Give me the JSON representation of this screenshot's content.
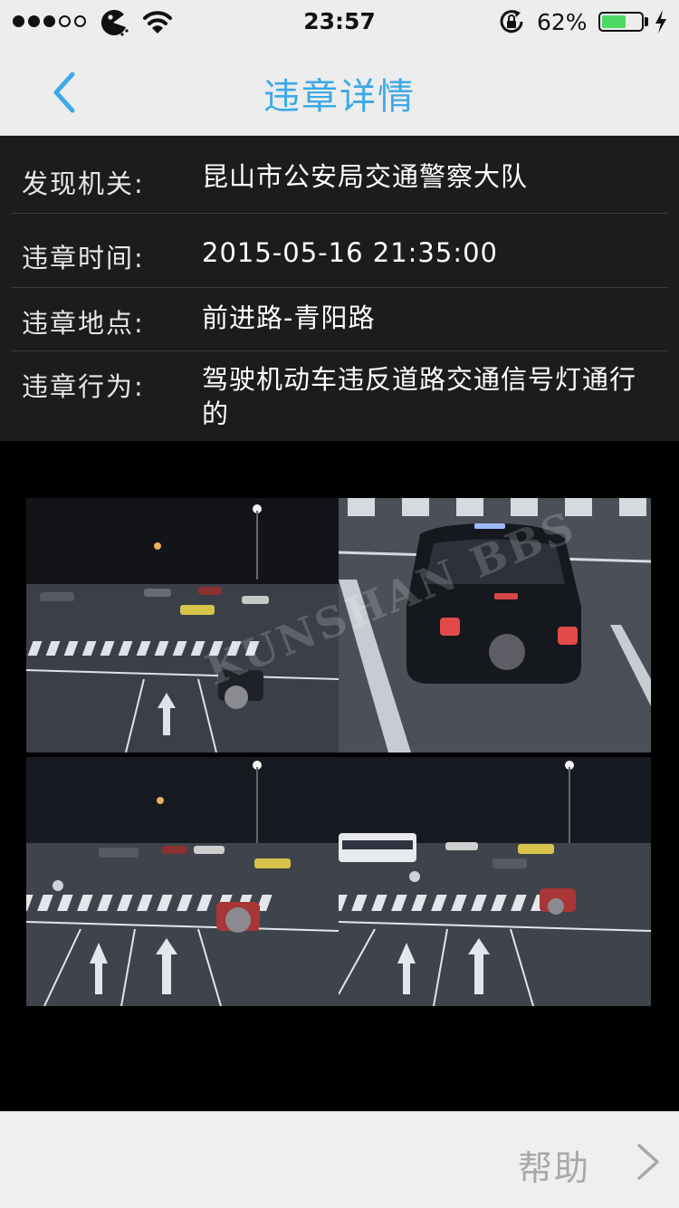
{
  "status_bar": {
    "time": "23:57",
    "battery_percent": "62%",
    "battery_level": 0.62,
    "signal_bars_filled": 3,
    "signal_bars_total": 5
  },
  "nav": {
    "title": "违章详情",
    "back_icon": "chevron-left-icon"
  },
  "violation": {
    "rows": [
      {
        "label": "发现机关:",
        "value": "昆山市公安局交通警察大队"
      },
      {
        "label": "违章时间:",
        "value": "2015-05-16 21:35:00"
      },
      {
        "label": "违章地点:",
        "value": "前进路-青阳路"
      },
      {
        "label": "违章行为:",
        "value": "驾驶机动车违反道路交通信号灯通行的"
      }
    ]
  },
  "photos": {
    "watermark": "KUNSHAN BBS"
  },
  "footer": {
    "help_label": "帮助",
    "help_icon": "chevron-right-icon"
  },
  "colors": {
    "accent": "#3DA9E6",
    "nav_background": "#EDEDED",
    "panel_background": "#1C1C1C",
    "battery_green": "#4CD964"
  }
}
